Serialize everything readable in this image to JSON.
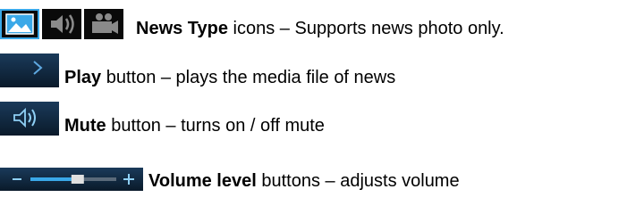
{
  "rows": [
    {
      "bold": "News Type",
      "rest": " icons – Supports news photo only.",
      "icons": [
        "photo-icon",
        "audio-icon",
        "video-icon"
      ]
    },
    {
      "bold": "Play",
      "rest": " button – plays the media file of news",
      "icon": "play-icon"
    },
    {
      "bold": "Mute",
      "rest": " button – turns on / off mute",
      "icon": "speaker-icon"
    },
    {
      "bold": "Volume level",
      "rest": " buttons – adjusts volume",
      "icon": "volume-slider-icon",
      "volume_level": 0.55
    }
  ],
  "colors": {
    "accent": "#3aa8e8",
    "icon_bg": "#0a0a0a",
    "icon_gray": "#8a8a8a"
  }
}
